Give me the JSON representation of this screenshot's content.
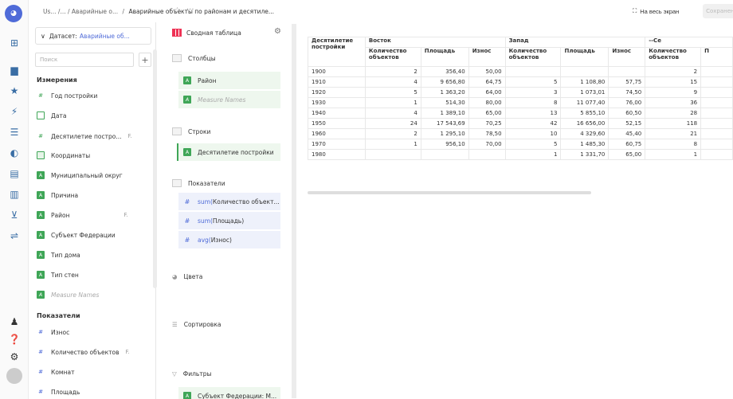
{
  "breadcrumbs": {
    "part1": "Us... /... / Аварийные о...",
    "sep": "/",
    "current": "Аварийные объекты по районам и десятиле..."
  },
  "topbar": {
    "fullscreen_label": "На весь экран",
    "save_label": "Сохранено"
  },
  "dataset": {
    "label": "Датасет:",
    "name": "Аварийные об..."
  },
  "search": {
    "placeholder": "Поиск"
  },
  "dimensions": {
    "title": "Измерения",
    "items": [
      {
        "label": "Год постройки",
        "icon": "hash-icon",
        "tag": ""
      },
      {
        "label": "Дата",
        "icon": "calendar-icon",
        "tag": ""
      },
      {
        "label": "Десятилетие постро...",
        "icon": "hash-icon",
        "tag": "F."
      },
      {
        "label": "Координаты",
        "icon": "location-icon",
        "tag": ""
      },
      {
        "label": "Муниципальный округ",
        "icon": "string-icon",
        "tag": ""
      },
      {
        "label": "Причина",
        "icon": "string-icon",
        "tag": ""
      },
      {
        "label": "Район",
        "icon": "string-icon",
        "tag": "F."
      },
      {
        "label": "Субъект Федерации",
        "icon": "string-icon",
        "tag": ""
      },
      {
        "label": "Тип дома",
        "icon": "string-icon",
        "tag": ""
      },
      {
        "label": "Тип стен",
        "icon": "string-icon",
        "tag": ""
      },
      {
        "label": "Measure Names",
        "icon": "string-icon",
        "tag": ""
      }
    ]
  },
  "measures": {
    "title": "Показатели",
    "items": [
      {
        "label": "Износ",
        "tag": ""
      },
      {
        "label": "Количество объектов",
        "tag": "F."
      },
      {
        "label": "Комнат",
        "tag": ""
      },
      {
        "label": "Площадь",
        "tag": ""
      }
    ]
  },
  "wizard": {
    "chart_type": "Сводная таблица",
    "columns_title": "Столбцы",
    "columns": [
      "Район",
      "Measure Names"
    ],
    "rows_title": "Строки",
    "rows": [
      "Десятилетие постройки"
    ],
    "measures_title": "Показатели",
    "measures": [
      {
        "fn": "sum(",
        "name": "Количество объект..."
      },
      {
        "fn": "sum(",
        "name": "Площадь)"
      },
      {
        "fn": "avg(",
        "name": "Износ)"
      }
    ],
    "colors_title": "Цвета",
    "sort_title": "Сортировка",
    "filters_title": "Фильтры",
    "filters": [
      "Субъект Федерации: М..."
    ]
  },
  "table": {
    "row_header": "Десятилетие постройки",
    "groups": [
      "Восток",
      "Запад",
      "--Се"
    ],
    "subheaders": [
      "Количество объектов",
      "Площадь",
      "Износ",
      "Количество объектов",
      "Площадь",
      "Износ",
      "Количество объектов",
      "П"
    ],
    "rows": [
      [
        "1900",
        "2",
        "356,40",
        "50,00",
        "",
        "",
        "",
        "2",
        ""
      ],
      [
        "1910",
        "4",
        "9 656,80",
        "64,75",
        "5",
        "1 108,80",
        "57,75",
        "15",
        ""
      ],
      [
        "1920",
        "5",
        "1 363,20",
        "64,00",
        "3",
        "1 073,01",
        "74,50",
        "9",
        ""
      ],
      [
        "1930",
        "1",
        "514,30",
        "80,00",
        "8",
        "11 077,40",
        "76,00",
        "36",
        ""
      ],
      [
        "1940",
        "4",
        "1 389,10",
        "65,00",
        "13",
        "5 855,10",
        "60,50",
        "28",
        ""
      ],
      [
        "1950",
        "24",
        "17 543,69",
        "70,25",
        "42",
        "16 656,00",
        "52,15",
        "118",
        ""
      ],
      [
        "1960",
        "2",
        "1 295,10",
        "78,50",
        "10",
        "4 329,60",
        "45,40",
        "21",
        ""
      ],
      [
        "1970",
        "1",
        "956,10",
        "70,00",
        "5",
        "1 485,30",
        "60,75",
        "8",
        ""
      ],
      [
        "1980",
        "",
        "",
        "",
        "1",
        "1 331,70",
        "65,00",
        "1",
        ""
      ]
    ]
  },
  "colors": {
    "accent": "#4f6bd8",
    "field_green": "#3fa657"
  }
}
